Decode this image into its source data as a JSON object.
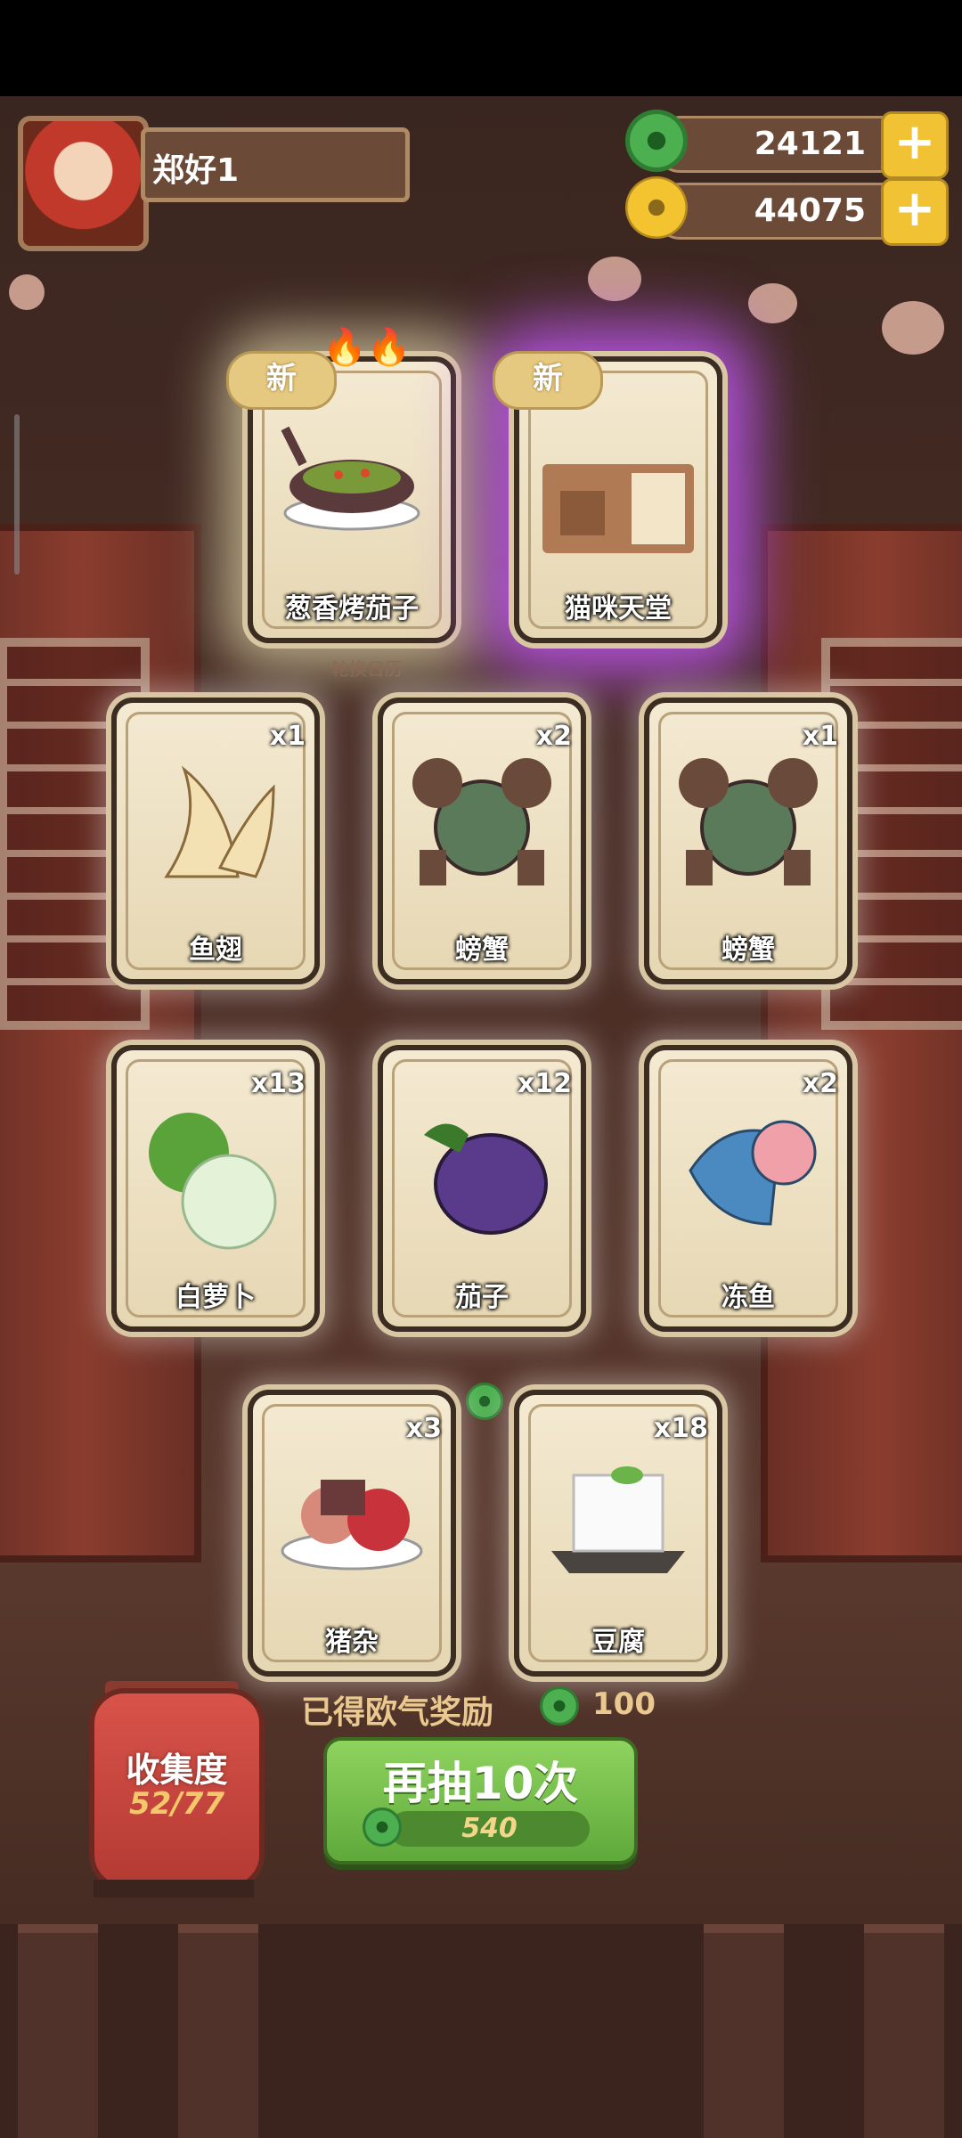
{
  "player": {
    "name": "郑好1"
  },
  "currencies": [
    {
      "icon": "jade-icon",
      "value": "24121"
    },
    {
      "icon": "coin-icon",
      "value": "44075"
    }
  ],
  "featured": [
    {
      "badge": "新",
      "label": "葱香烤茄子"
    },
    {
      "badge": "新",
      "label": "猫咪天堂"
    }
  ],
  "featured_subtitle": "轮换日历",
  "cards": [
    {
      "label": "鱼翅",
      "count": "x1"
    },
    {
      "label": "螃蟹",
      "count": "x2"
    },
    {
      "label": "螃蟹",
      "count": "x1"
    },
    {
      "label": "白萝卜",
      "count": "x13"
    },
    {
      "label": "茄子",
      "count": "x12"
    },
    {
      "label": "冻鱼",
      "count": "x2"
    },
    {
      "label": "猪杂",
      "count": "x3"
    },
    {
      "label": "豆腐",
      "count": "x18"
    }
  ],
  "reward": {
    "label": "已得欧气奖励",
    "value": "100"
  },
  "draw_button": {
    "label": "再抽10次",
    "cost": "540"
  },
  "collection": {
    "title": "收集度",
    "progress": "52/77"
  },
  "colors": {
    "accent_green": "#6bb844",
    "gold": "#f2c235",
    "purple_glow": "#c85aff"
  }
}
